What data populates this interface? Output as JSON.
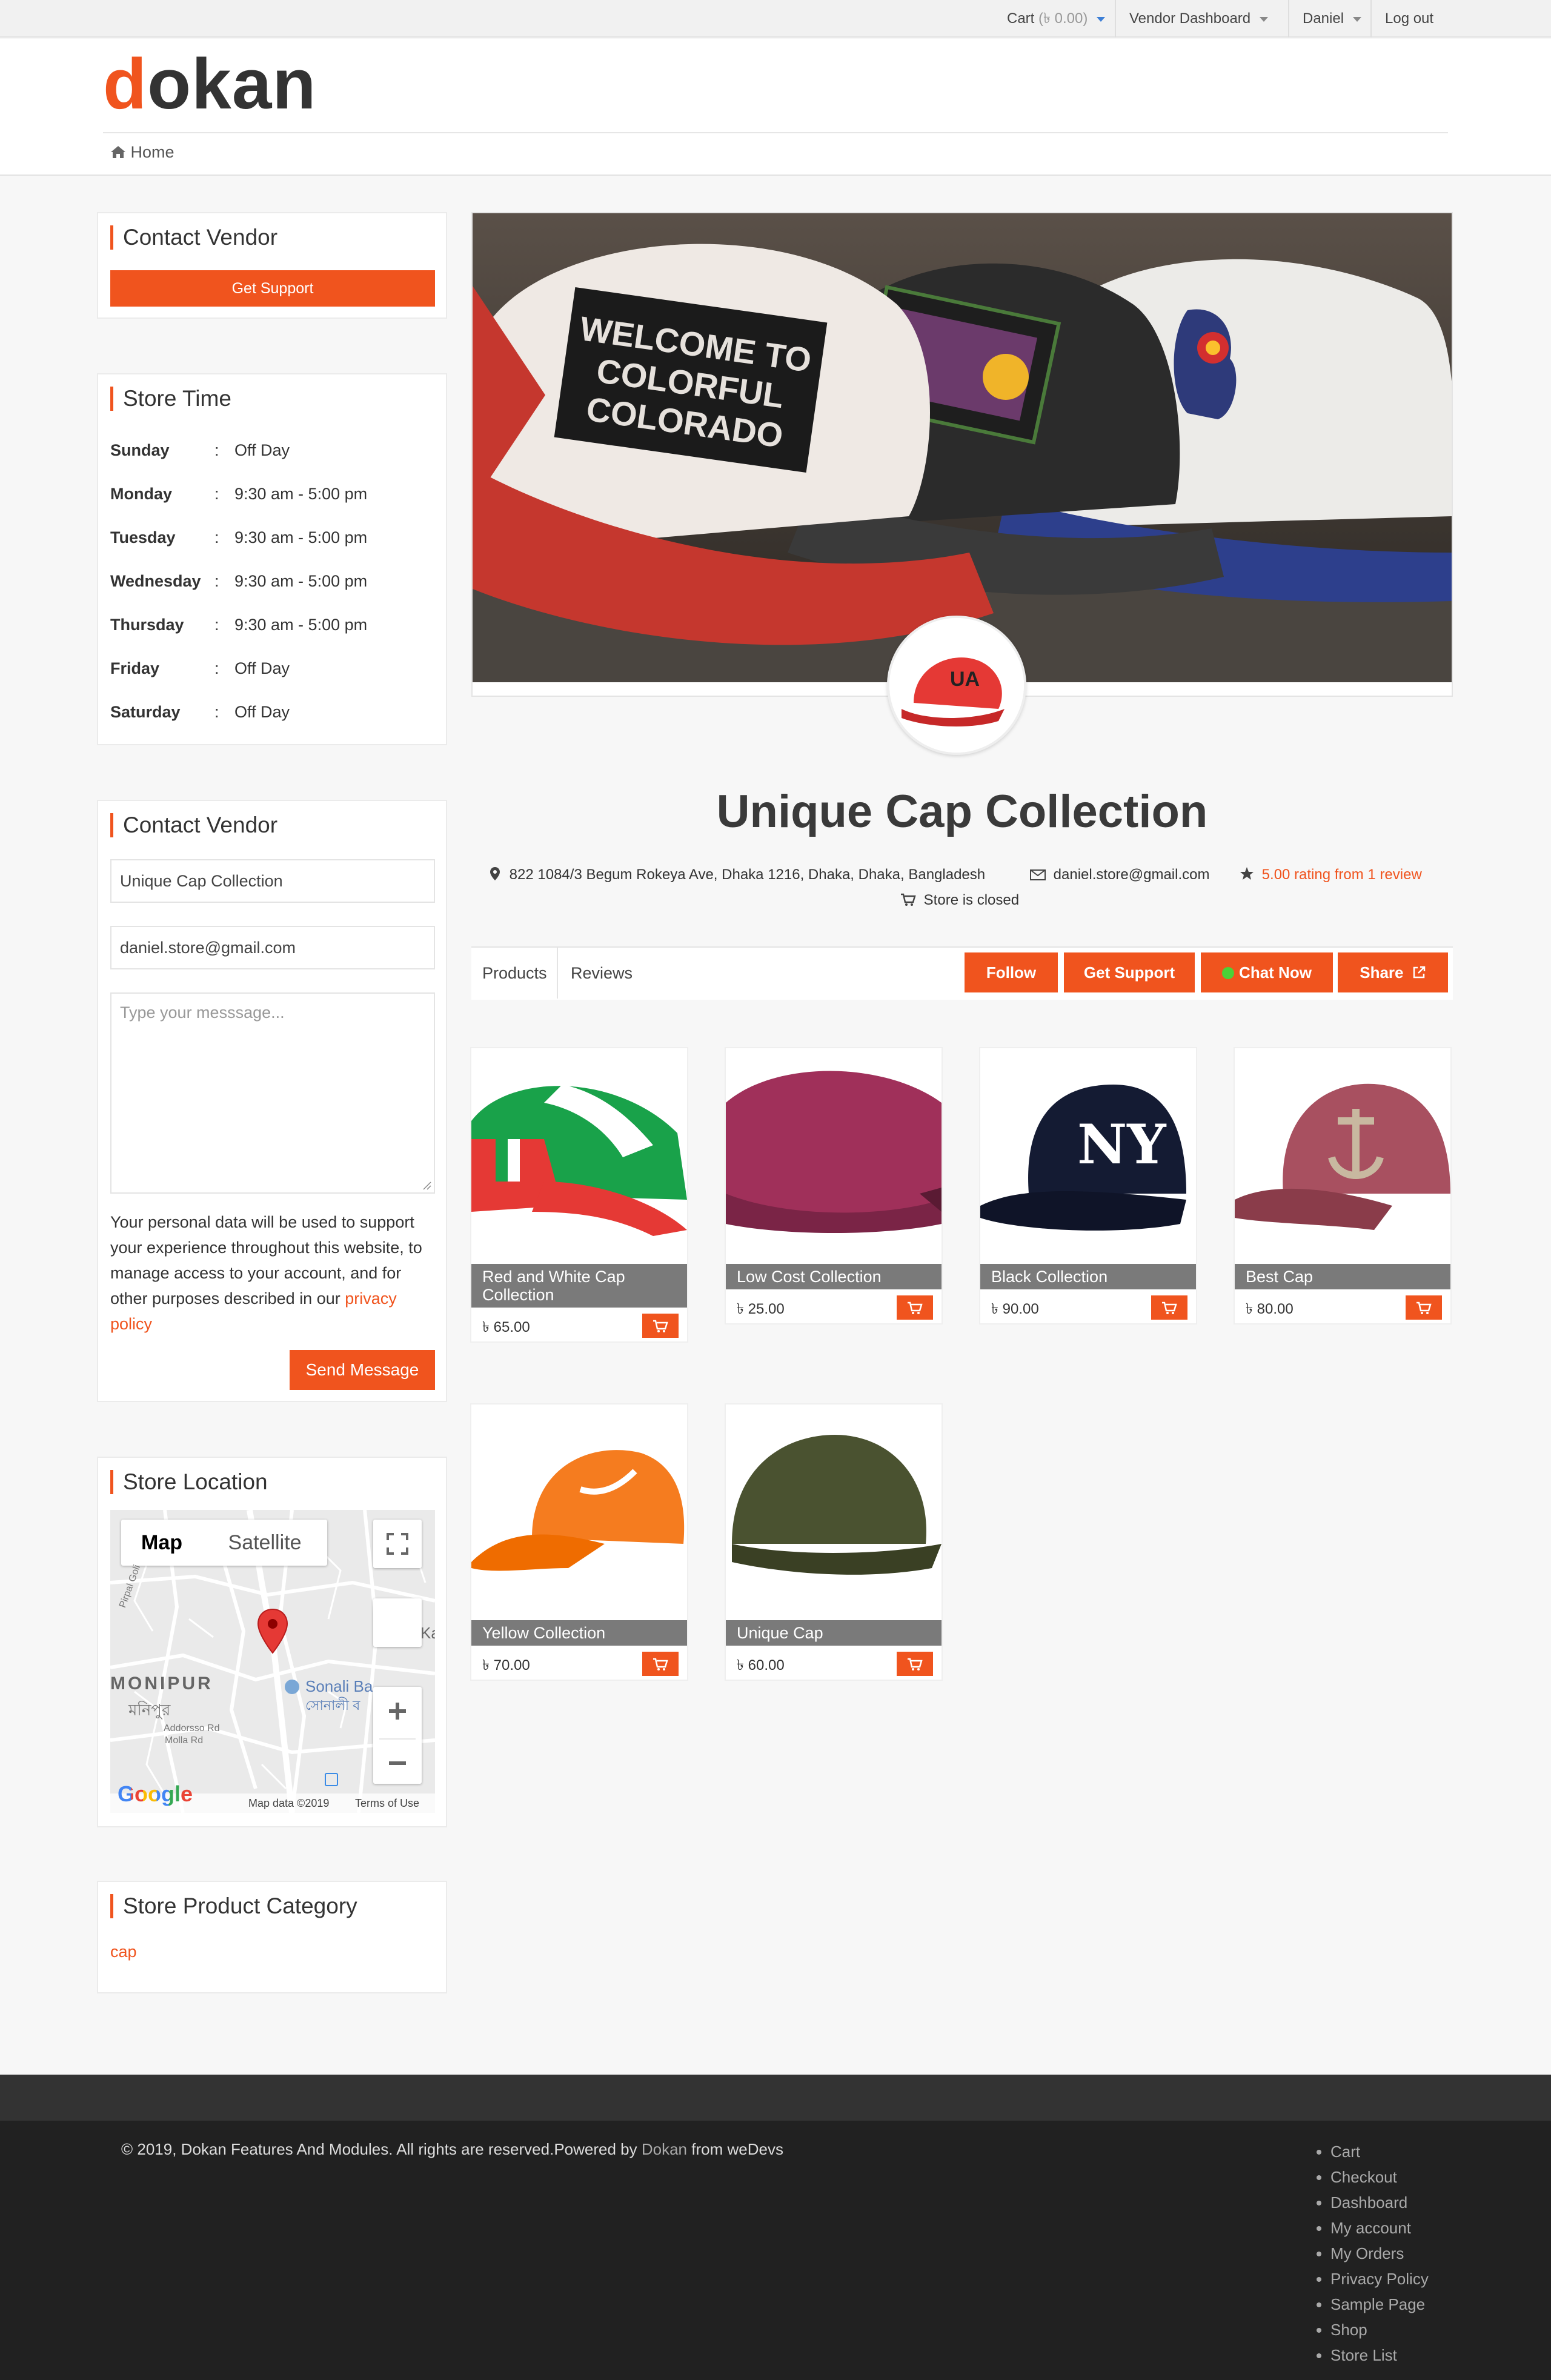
{
  "topbar": {
    "cart_label": "Cart",
    "cart_amount": "(৳ 0.00)",
    "vendor_dashboard": "Vendor Dashboard",
    "user": "Daniel",
    "logout": "Log out"
  },
  "header": {
    "logo_first": "d",
    "logo_rest": "okan",
    "breadcrumb_home": "Home"
  },
  "sidebar": {
    "contact_top": {
      "title": "Contact Vendor",
      "button": "Get Support"
    },
    "store_time": {
      "title": "Store Time",
      "rows": [
        {
          "day": "Sunday",
          "colon": ":",
          "hours": "Off Day"
        },
        {
          "day": "Monday",
          "colon": ":",
          "hours": "9:30 am - 5:00 pm"
        },
        {
          "day": "Tuesday",
          "colon": ":",
          "hours": "9:30 am - 5:00 pm"
        },
        {
          "day": "Wednesday",
          "colon": ":",
          "hours": "9:30 am - 5:00 pm"
        },
        {
          "day": "Thursday",
          "colon": ":",
          "hours": "9:30 am - 5:00 pm"
        },
        {
          "day": "Friday",
          "colon": ":",
          "hours": "Off Day"
        },
        {
          "day": "Saturday",
          "colon": ":",
          "hours": "Off Day"
        }
      ]
    },
    "contact_form": {
      "title": "Contact Vendor",
      "name_value": "Unique Cap Collection",
      "email_value": "daniel.store@gmail.com",
      "message_placeholder": "Type your messsage...",
      "privacy_text": "Your personal data will be used to support your experience throughout this website, to manage access to your account, and for other purposes described in our",
      "privacy_link": "privacy policy",
      "send_button": "Send Message"
    },
    "location": {
      "title": "Store Location",
      "tab_map": "Map",
      "tab_satellite": "Satellite",
      "area_label": "MONIPUR",
      "area_label_bn": "মনিপুর",
      "poi": "Sonali Ba",
      "poi_bn": "সোনালী ব",
      "road1": "Addorsso Rd",
      "road2": "Molla Rd",
      "road3": "Pirpal Goli",
      "edge": "Ka",
      "google": "Google",
      "map_data": "Map data ©2019",
      "terms": "Terms of Use"
    },
    "category": {
      "title": "Store Product Category",
      "item": "cap"
    }
  },
  "store": {
    "name": "Unique Cap Collection",
    "address": "822 1084/3 Begum Rokeya Ave, Dhaka 1216, Dhaka, Dhaka, Bangladesh",
    "email": "daniel.store@gmail.com",
    "rating": "5.00 rating from 1 review",
    "status": "Store is closed",
    "banner_text": [
      "WELCOME TO",
      "COLORFUL",
      "COLORADO"
    ],
    "tabs": [
      "Products",
      "Reviews"
    ],
    "buttons": {
      "follow": "Follow",
      "support": "Get Support",
      "chat": "Chat Now",
      "share": "Share"
    }
  },
  "products": [
    {
      "name": "Red and White Cap Collection",
      "price": "৳ 65.00"
    },
    {
      "name": "Low Cost Collection",
      "price": "৳ 25.00"
    },
    {
      "name": "Black Collection",
      "price": "৳ 90.00"
    },
    {
      "name": "Best Cap",
      "price": "৳ 80.00"
    },
    {
      "name": "Yellow Collection",
      "price": "৳ 70.00"
    },
    {
      "name": "Unique Cap",
      "price": "৳ 60.00"
    }
  ],
  "footer": {
    "copyright": "© 2019, Dokan Features And Modules. All rights are reserved.Powered by",
    "powered_link": "Dokan",
    "from": "from",
    "company": "weDevs",
    "menu": [
      "Cart",
      "Checkout",
      "Dashboard",
      "My account",
      "My Orders",
      "Privacy Policy",
      "Sample Page",
      "Shop",
      "Store List"
    ]
  },
  "colors": {
    "accent": "#f0541e",
    "chat_online": "#4cd137",
    "footer_bg": "#212121"
  }
}
